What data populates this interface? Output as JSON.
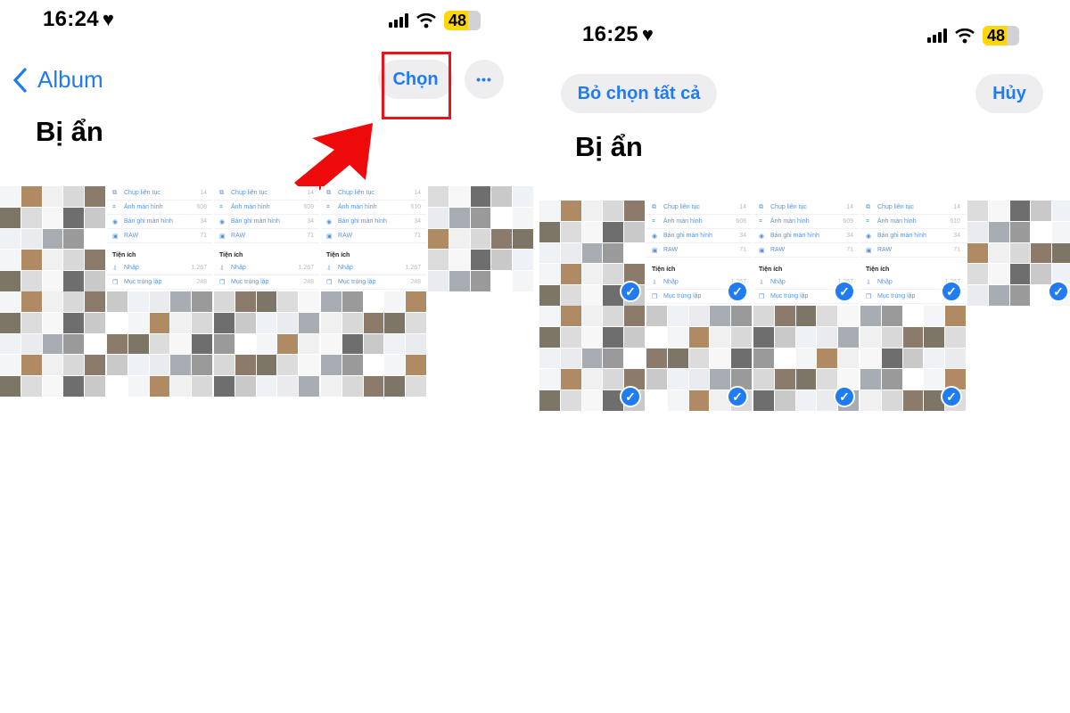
{
  "left_screen": {
    "status_bar": {
      "time": "16:24",
      "heart_icon": "♥",
      "battery": "48"
    },
    "nav": {
      "back_label": "Album",
      "select_label": "Chọn",
      "more_label": "•••"
    },
    "title": "Bị ẩn",
    "annotation": {
      "highlight_color": "#e8141a",
      "arrow_color": "#ee0a0a"
    }
  },
  "right_screen": {
    "status_bar": {
      "time": "16:25",
      "heart_icon": "♥",
      "battery": "48"
    },
    "nav": {
      "deselect_all_label": "Bỏ chọn tất cả",
      "cancel_label": "Hủy"
    },
    "title": "Bị ẩn",
    "check_icon": "✓"
  },
  "thumbnail_list": {
    "rows": [
      {
        "icon": "⧉",
        "label": "Chụp liên tục"
      },
      {
        "icon": "⌗",
        "label": "Ảnh màn hình"
      },
      {
        "icon": "◉",
        "label": "Bản ghi màn hình"
      },
      {
        "icon": "▣",
        "label": "RAW"
      }
    ],
    "section": "Tiện ích",
    "utility_rows": [
      {
        "icon": "⇩",
        "label": "Nhập"
      },
      {
        "icon": "❐",
        "label": "Mục trùng lặp"
      }
    ],
    "counts": [
      [
        "14",
        "608",
        "34",
        "71",
        "1.267",
        "248"
      ],
      [
        "14",
        "609",
        "34",
        "71",
        "1.267",
        "248"
      ],
      [
        "14",
        "610",
        "34",
        "71",
        "1.267",
        "248"
      ]
    ]
  },
  "colors": {
    "accent": "#1f7cf3",
    "pill_bg": "#eeeef0"
  }
}
